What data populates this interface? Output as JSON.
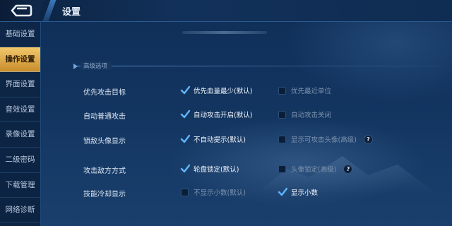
{
  "header": {
    "title": "设置"
  },
  "sidebar": {
    "items": [
      {
        "label": "基础设置"
      },
      {
        "label": "操作设置"
      },
      {
        "label": "界面设置"
      },
      {
        "label": "音效设置"
      },
      {
        "label": "录像设置"
      },
      {
        "label": "二级密码"
      },
      {
        "label": "下载管理"
      },
      {
        "label": "网络诊断"
      }
    ],
    "active_index": 1
  },
  "section": {
    "label": "高级选项"
  },
  "rows": [
    {
      "label": "优先攻击目标",
      "opt1": "优先血量最少(默认)",
      "opt1_checked": true,
      "opt2": "优先最近单位",
      "opt2_checked": false
    },
    {
      "label": "自动普通攻击",
      "opt1": "自动攻击开启(默认)",
      "opt1_checked": true,
      "opt2": "自动攻击关闭",
      "opt2_checked": false
    },
    {
      "label": "锁敌头像显示",
      "opt1": "不自动提示(默认)",
      "opt1_checked": true,
      "opt2": "显示可攻击头像(高级)",
      "opt2_checked": false,
      "help": "?"
    },
    {
      "label": "攻击敌方方式",
      "opt1": "轮盘锁定(默认)",
      "opt1_checked": true,
      "opt2": "头像锁定(高级)",
      "opt2_checked": false,
      "help": "?"
    },
    {
      "label": "技能冷却显示",
      "opt1": "不显示小数(默认)",
      "opt1_checked": false,
      "opt2": "显示小数",
      "opt2_checked": true
    }
  ],
  "icons": {
    "back": "back-arrow-icon",
    "check": "checkmark-icon",
    "help": "question-icon"
  },
  "colors": {
    "accent": "#f2c86c",
    "check": "#5fb6ff",
    "background": "#12345f"
  }
}
